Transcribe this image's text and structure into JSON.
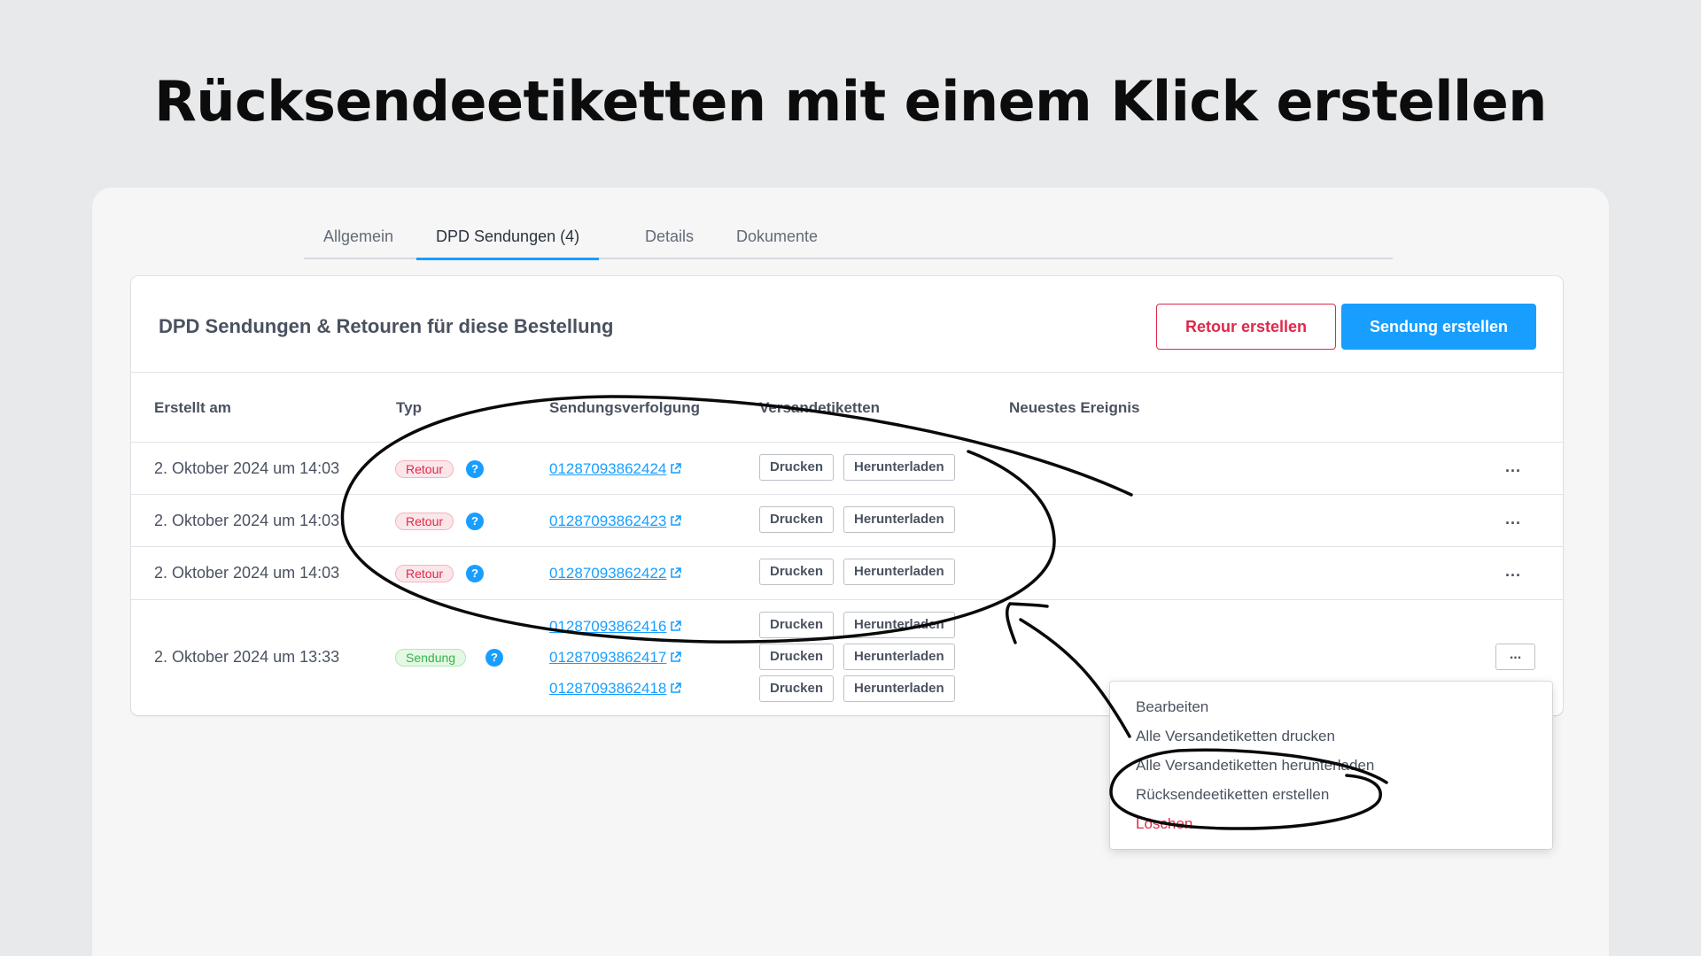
{
  "headline": "Rücksendeetiketten mit einem Klick erstellen",
  "tabs": [
    {
      "label": "Allgemein"
    },
    {
      "label": "DPD Sendungen (4)"
    },
    {
      "label": "Details"
    },
    {
      "label": "Dokumente"
    }
  ],
  "panel": {
    "title": "DPD Sendungen & Retouren für diese Bestellung",
    "retour_button": "Retour erstellen",
    "send_button": "Sendung erstellen"
  },
  "columns": [
    "Erstellt am",
    "Typ",
    "Sendungsverfolgung",
    "Versandetiketten",
    "Neuestes Ereignis"
  ],
  "labels": {
    "print": "Drucken",
    "download": "Herunterladen",
    "more": "..."
  },
  "rows": [
    {
      "date": "2. Oktober 2024 um 14:03",
      "type": "Retour",
      "tracking": [
        "01287093862424"
      ]
    },
    {
      "date": "2. Oktober 2024 um 14:03",
      "type": "Retour",
      "tracking": [
        "01287093862423"
      ]
    },
    {
      "date": "2. Oktober 2024 um 14:03",
      "type": "Retour",
      "tracking": [
        "01287093862422"
      ]
    },
    {
      "date": "2. Oktober 2024 um 13:33",
      "type": "Sendung",
      "tracking": [
        "01287093862416",
        "01287093862417",
        "01287093862418"
      ]
    }
  ],
  "menu": [
    {
      "label": "Bearbeiten"
    },
    {
      "label": "Alle Versandetiketten drucken"
    },
    {
      "label": "Alle Versandetiketten herunterladen"
    },
    {
      "label": "Rücksendeetiketten erstellen"
    },
    {
      "label": "Löschen"
    }
  ],
  "colors": {
    "accent": "#189eff",
    "danger": "#de294c",
    "success": "#37b24d"
  }
}
